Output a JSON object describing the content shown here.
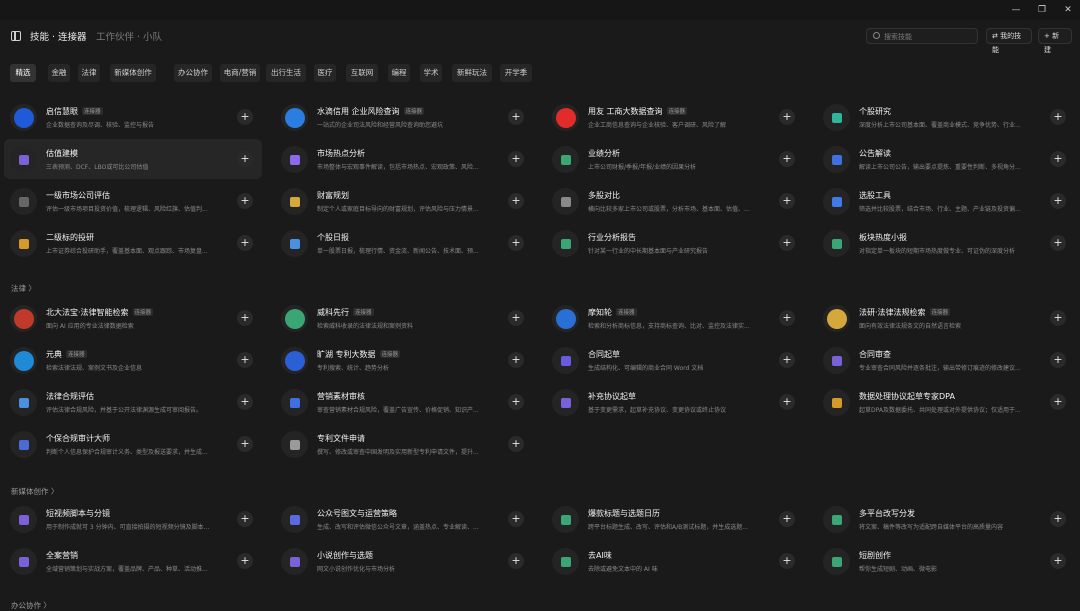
{
  "window": {
    "minimize": "—",
    "maximize": "❐",
    "close": "✕"
  },
  "header": {
    "title": "技能 · 连接器",
    "subtitle": "工作伙伴 · 小队",
    "search_placeholder": "搜索技能",
    "my_skills": "我的技能",
    "new": "新建"
  },
  "filters": [
    "精选",
    "金融",
    "法律",
    "新媒体创作",
    "办公协作",
    "电商/营销",
    "出行生活",
    "医疗",
    "互联网",
    "编程",
    "学术",
    "新鲜玩法",
    "开学季"
  ],
  "connector_tag": "连接器",
  "add_glyph": "+",
  "sections": [
    {
      "label": "",
      "cards": [
        {
          "name": "启信慧眼",
          "connector": true,
          "desc": "企业数据查询及尽调、核验、监控与报告",
          "icon": "shield-logo-icon",
          "color": "#1f5bd8"
        },
        {
          "name": "水滴信用 企业风险查询",
          "connector": true,
          "desc": "一站式的企业司法风险和经营风险查询助您避坑",
          "icon": "water-drop-logo-icon",
          "color": "#2a7de1"
        },
        {
          "name": "用友 工商大数据查询",
          "connector": true,
          "desc": "企业工商信息查询与企业核验、客户调研、风险了解",
          "icon": "yonyou-logo-icon",
          "color": "#e22b2b"
        },
        {
          "name": "个股研究",
          "connector": false,
          "desc": "深度分析上市公司基本面、覆盖商业模式、竞争优势、行业...",
          "icon": "stock-research-icon",
          "color": "#2fb59a"
        },
        {
          "name": "估值建模",
          "connector": false,
          "desc": "三表预测、DCF、LBO或可比公司估值",
          "icon": "valuation-icon",
          "color": "#7b61d9"
        },
        {
          "name": "市场热点分析",
          "connector": false,
          "desc": "市场整体与宏观事件解读，包括市场热点、宏观政策、风险...",
          "icon": "flame-icon",
          "color": "#8a6bf0"
        },
        {
          "name": "业绩分析",
          "connector": false,
          "desc": "上市公司财报/季报/年报/业绩的因果分析",
          "icon": "bar-chart-icon",
          "color": "#3aa676"
        },
        {
          "name": "公告解读",
          "connector": false,
          "desc": "解读上市公司公告，输出要点提炼、重要性判断、多视角分...",
          "icon": "briefcase-icon",
          "color": "#3f6fe0"
        },
        {
          "name": "一级市场公司评估",
          "connector": false,
          "desc": "评估一级市场项目投资价值，梳理逻辑、风险红旗、估值判...",
          "icon": "building-icon",
          "color": "#666666"
        },
        {
          "name": "财富规划",
          "connector": false,
          "desc": "制定个人或家庭目标导向的财富规划，评估风险与压力情景...",
          "icon": "money-bag-icon",
          "color": "#d4a83a"
        },
        {
          "name": "多股对比",
          "connector": false,
          "desc": "横向比较多家上市公司或股票，分析市场、基本面、估值、...",
          "icon": "compare-bars-icon",
          "color": "#8a8a8a"
        },
        {
          "name": "选股工具",
          "connector": false,
          "desc": "筛选并比较股票，结合市场、行业、主题、产业链及投资偏...",
          "icon": "filter-funnel-icon",
          "color": "#3f7ae8"
        },
        {
          "name": "二级标的投研",
          "connector": false,
          "desc": "上市证券综合投研助手，覆盖基本面、观点跟踪、市场复盘...",
          "icon": "coin-icon",
          "color": "#d49a2a"
        },
        {
          "name": "个股日报",
          "connector": false,
          "desc": "单一股票日报，梳理行情、资金流、新闻公告、技术面、预...",
          "icon": "daily-report-icon",
          "color": "#4a8fe0"
        },
        {
          "name": "行业分析报告",
          "connector": false,
          "desc": "针对某一行业的中长期基本面与产业研究报告",
          "icon": "industry-report-icon",
          "color": "#3aa676"
        },
        {
          "name": "板块热度小报",
          "connector": false,
          "desc": "对指定单一板块的短期市场热度做专业、可证伪的深度分析",
          "icon": "sector-heat-icon",
          "color": "#3aa676"
        }
      ]
    },
    {
      "label": "法律 〉",
      "cards": [
        {
          "name": "北大法宝·法律智能检索",
          "connector": true,
          "desc": "面向 AI 应用的专业法律数据检索",
          "icon": "pkulaw-logo-icon",
          "color": "#c0392b"
        },
        {
          "name": "威科先行",
          "connector": true,
          "desc": "检索威科收录的法律法规和案例资料",
          "icon": "wolters-logo-icon",
          "color": "#3aa676"
        },
        {
          "name": "摩知轮",
          "connector": true,
          "desc": "检索和分析商标信息，支持商标查询、比对、监控及法律实...",
          "icon": "mozhilun-logo-icon",
          "color": "#2a6fd6"
        },
        {
          "name": "法研·法律法规检索",
          "connector": true,
          "desc": "面向有效法律法规条文的自然语言检索",
          "icon": "cjbdi-logo-icon",
          "color": "#d4a83a"
        },
        {
          "name": "元典",
          "connector": true,
          "desc": "检索法律法规、案例文书及企业信息",
          "icon": "yuandian-logo-icon",
          "color": "#1f8ad6"
        },
        {
          "name": "旷湖 专利大数据",
          "connector": true,
          "desc": "专利搜索、统计、趋势分析",
          "icon": "kuanghu-logo-icon",
          "color": "#2a5fd6"
        },
        {
          "name": "合同起草",
          "connector": false,
          "desc": "生成结构化、可编辑的商业合同 Word 文档",
          "icon": "contract-draft-icon",
          "color": "#6a5ae0"
        },
        {
          "name": "合同审查",
          "connector": false,
          "desc": "专业审查合同风险并逐条批注，输出带修订痕迹的修改建议...",
          "icon": "contract-review-icon",
          "color": "#7b61d9"
        },
        {
          "name": "法律合规评估",
          "connector": false,
          "desc": "评估法律合规风险，并基于公开法律渊源生成可审阅报告。",
          "icon": "scales-icon",
          "color": "#4a8fe0"
        },
        {
          "name": "营销素材审核",
          "connector": false,
          "desc": "审查营销素材合规风险，覆盖广告宣传、价格促销、知识产...",
          "icon": "person-review-icon",
          "color": "#3f6fe0"
        },
        {
          "name": "补充协议起草",
          "connector": false,
          "desc": "基于变更需求，起草补充协议、变更协议或终止协议",
          "icon": "supplement-doc-icon",
          "color": "#7b61d9"
        },
        {
          "name": "数据处理协议起草专家DPA",
          "connector": false,
          "desc": "起草DPA及数据委托、共同处理或对外提供协议；仅适用于...",
          "icon": "dpa-doc-icon",
          "color": "#d49a2a"
        },
        {
          "name": "个保合规审计大师",
          "connector": false,
          "desc": "判断个人信息保护合规审计义务、类型及报送要求，并生成...",
          "icon": "audit-icon",
          "color": "#4a6ad6"
        },
        {
          "name": "专利文件申请",
          "connector": false,
          "desc": "撰写、修改或审查中国发明及实用新型专利申请文件，提升...",
          "icon": "patent-doc-icon",
          "color": "#9a9a9a"
        }
      ]
    },
    {
      "label": "新媒体创作 〉",
      "cards": [
        {
          "name": "短视频脚本与分镜",
          "connector": false,
          "desc": "用于制作成就可 3 分钟内、可直接拍摄的短视频分镜及脚本...",
          "icon": "video-script-icon",
          "color": "#7b61d9"
        },
        {
          "name": "公众号图文与运营策略",
          "connector": false,
          "desc": "生成、改写和评估微信公众号文章，涵盖热点、专业解读、...",
          "icon": "wechat-article-icon",
          "color": "#5a6ae0"
        },
        {
          "name": "爆款标题与选题日历",
          "connector": false,
          "desc": "跨平台标题生成、改写、评估和A/B测试标题，并生成选题...",
          "icon": "calendar-icon",
          "color": "#3aa676"
        },
        {
          "name": "多平台改写分发",
          "connector": false,
          "desc": "将文案、稿件等改写为适配跨自媒体平台的高质量内容",
          "icon": "share-icon",
          "color": "#3aa676"
        },
        {
          "name": "全案营销",
          "connector": false,
          "desc": "全域营销策划与实战方案，覆盖品牌、产品、种草、活动推...",
          "icon": "cube-icon",
          "color": "#7b61d9"
        },
        {
          "name": "小说创作与选题",
          "connector": false,
          "desc": "网文小说创作优化与市场分析",
          "icon": "novel-icon",
          "color": "#7b61d9"
        },
        {
          "name": "去AI味",
          "connector": false,
          "desc": "去除或避免文本中的 AI 味",
          "icon": "sparkle-icon",
          "color": "#3aa676"
        },
        {
          "name": "短剧创作",
          "connector": false,
          "desc": "帮你生成短剧、动画、微电影",
          "icon": "short-drama-icon",
          "color": "#3aa676"
        }
      ]
    },
    {
      "label": "办公协作 〉",
      "cards": []
    }
  ]
}
